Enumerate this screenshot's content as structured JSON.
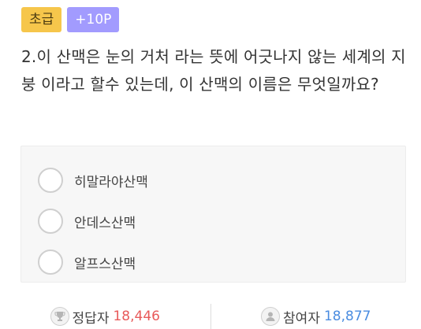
{
  "badges": {
    "level": "초급",
    "points": "+10P"
  },
  "question": {
    "text": "2.이 산맥은 눈의 거처 라는 뜻에 어긋나지 않는 세계의 지붕 이라고 할수 있는데, 이 산맥의 이름은 무엇일까요?"
  },
  "options": [
    {
      "label": "히말라야산맥"
    },
    {
      "label": "안데스산맥"
    },
    {
      "label": "알프스산맥"
    }
  ],
  "stats": {
    "correct_label": "정답자",
    "correct_value": "18,446",
    "correct_icon": "trophy-icon",
    "participants_label": "참여자",
    "participants_value": "18,877",
    "participants_icon": "person-icon"
  },
  "colors": {
    "level_badge": "#f6c64b",
    "points_badge": "#a29bfe",
    "correct_value": "#e85a5a",
    "participants_value": "#4a8ce0"
  }
}
